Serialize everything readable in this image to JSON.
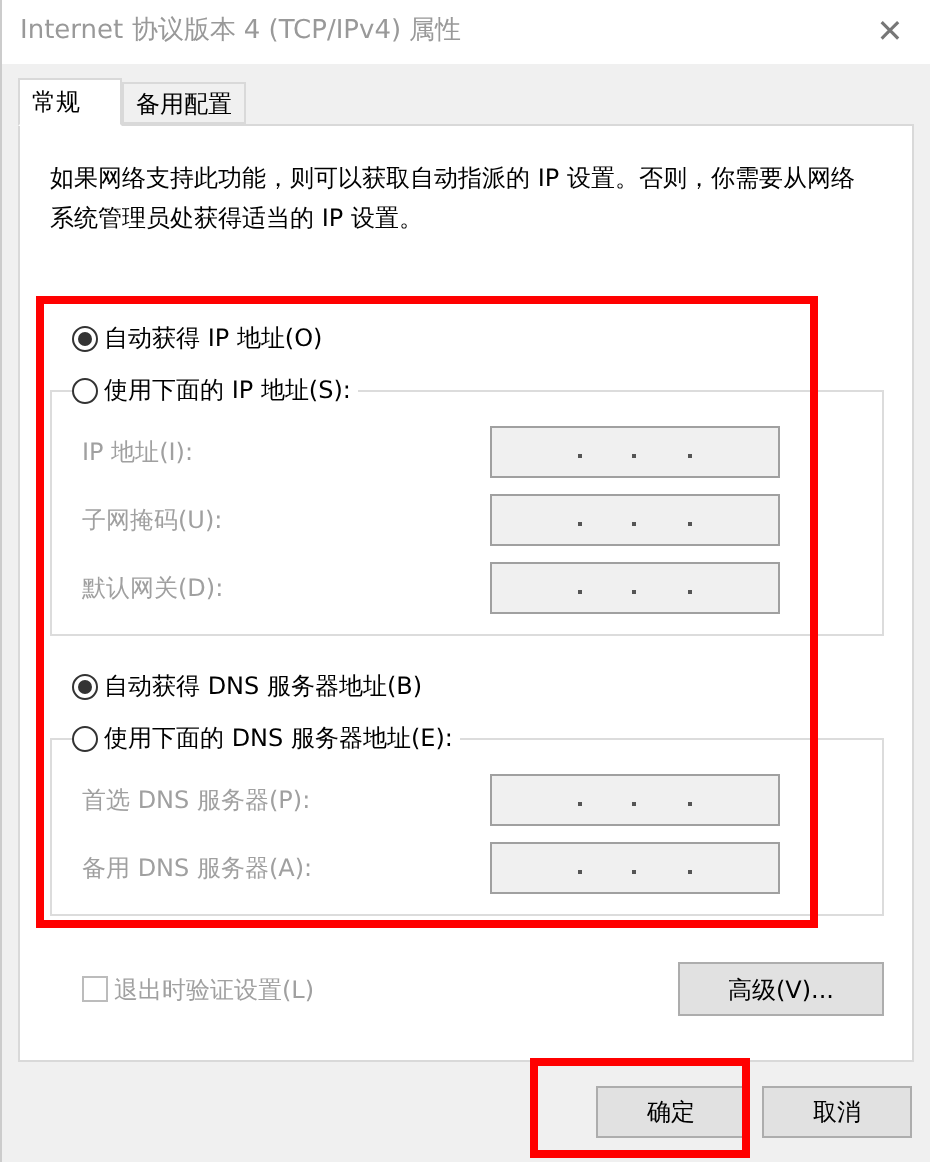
{
  "window": {
    "title": "Internet 协议版本 4 (TCP/IPv4) 属性",
    "close": "✕"
  },
  "tabs": [
    {
      "label": "常规",
      "selected": true
    },
    {
      "label": "备用配置",
      "selected": false
    }
  ],
  "description": "如果网络支持此功能，则可以获取自动指派的 IP 设置。否则，你需要从网络系统管理员处获得适当的 IP 设置。",
  "ip_section": {
    "options": [
      {
        "label": "自动获得 IP 地址(O)",
        "selected": true
      },
      {
        "label": "使用下面的 IP 地址(S):",
        "selected": false
      }
    ],
    "fields": [
      {
        "label": "IP 地址(I):",
        "disabled": true
      },
      {
        "label": "子网掩码(U):",
        "disabled": true
      },
      {
        "label": "默认网关(D):",
        "disabled": true
      }
    ]
  },
  "dns_section": {
    "options": [
      {
        "label": "自动获得 DNS 服务器地址(B)",
        "selected": true
      },
      {
        "label": "使用下面的 DNS 服务器地址(E):",
        "selected": false
      }
    ],
    "fields": [
      {
        "label": "首选 DNS 服务器(P):",
        "disabled": true
      },
      {
        "label": "备用 DNS 服务器(A):",
        "disabled": true
      }
    ]
  },
  "validate_checkbox": {
    "label": "退出时验证设置(L)",
    "checked": false,
    "disabled": true
  },
  "advanced_button": "高级(V)...",
  "buttons": [
    "确定",
    "取消"
  ]
}
